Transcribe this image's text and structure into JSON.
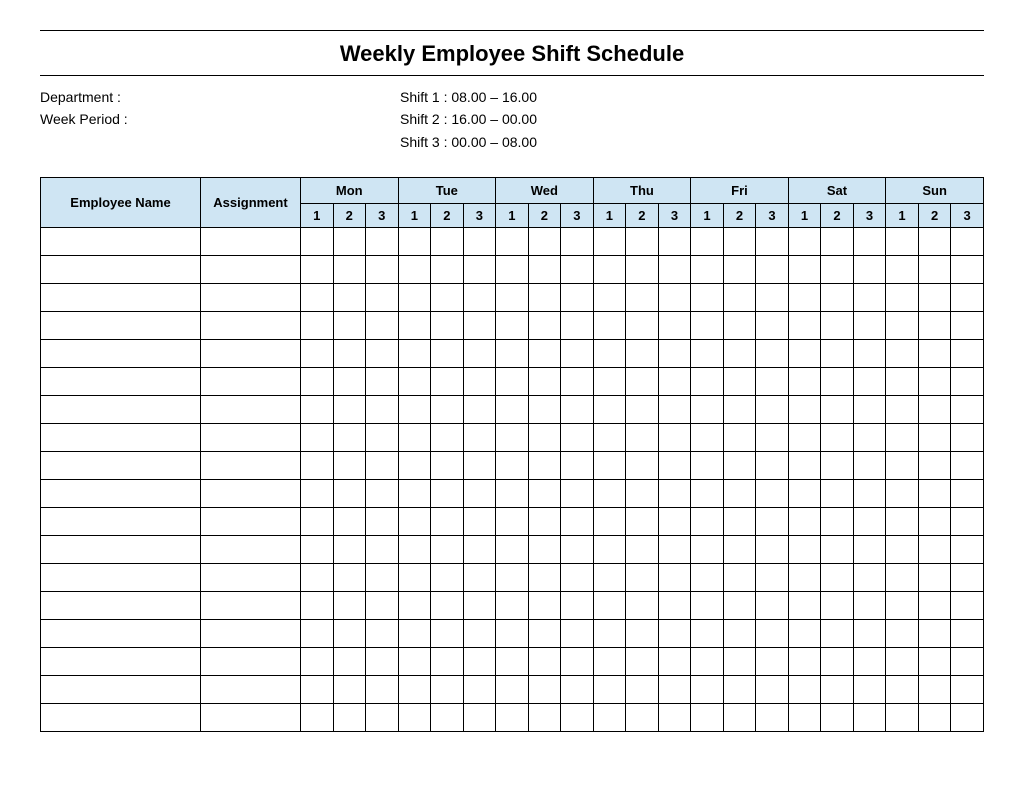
{
  "title": "Weekly Employee Shift Schedule",
  "meta": {
    "department_label": "Department    :",
    "week_period_label": "Week  Period :",
    "shift1": "Shift 1 : 08.00  – 16.00",
    "shift2": "Shift 2 : 16.00  – 00.00",
    "shift3": "Shift 3 : 00.00  – 08.00"
  },
  "headers": {
    "employee_name": "Employee Name",
    "assignment": "Assignment",
    "days": [
      "Mon",
      "Tue",
      "Wed",
      "Thu",
      "Fri",
      "Sat",
      "Sun"
    ],
    "shifts": [
      "1",
      "2",
      "3"
    ]
  },
  "row_count": 18
}
